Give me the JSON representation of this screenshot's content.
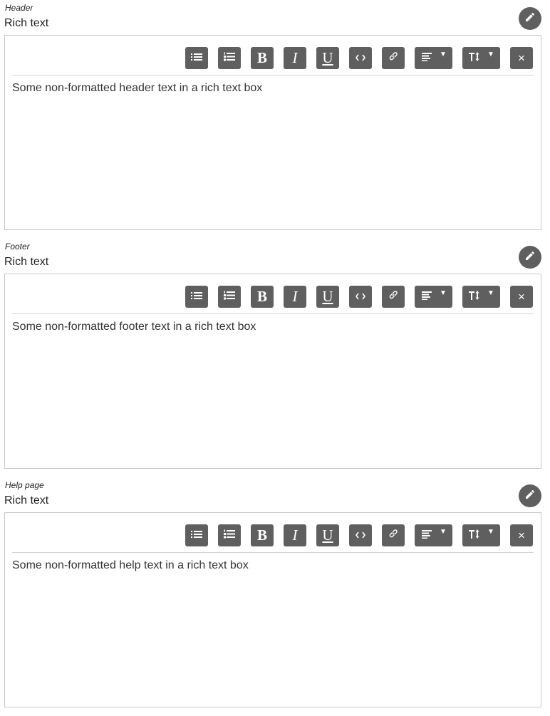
{
  "sections": [
    {
      "label": "Header",
      "type": "Rich text",
      "content": "Some non-formatted header text in a rich text box"
    },
    {
      "label": "Footer",
      "type": "Rich text",
      "content": "Some non-formatted footer text in a rich text box"
    },
    {
      "label": "Help page",
      "type": "Rich text",
      "content": "Some non-formatted help text in a rich text box"
    }
  ],
  "toolbar": {
    "bold_glyph": "B",
    "italic_glyph": "I",
    "underline_glyph": "U",
    "close_glyph": "×"
  },
  "icons": [
    "pencil-icon",
    "bulleted-list-icon",
    "numbered-list-icon",
    "bold-icon",
    "italic-icon",
    "underline-icon",
    "code-icon",
    "link-icon",
    "align-icon",
    "text-size-icon",
    "close-icon",
    "chevron-down-icon"
  ],
  "colors": {
    "button_bg": "#5f5f5f",
    "border": "#c8c8c8",
    "separator": "#d4d4d4"
  }
}
